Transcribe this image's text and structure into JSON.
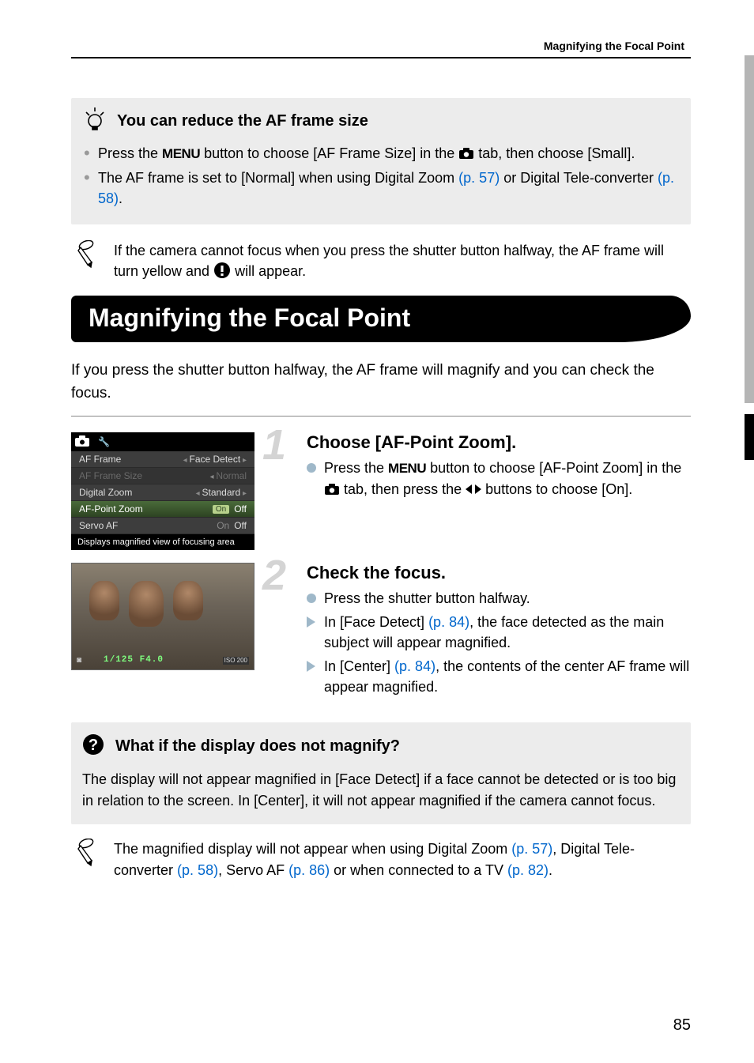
{
  "header": {
    "section": "Magnifying the Focal Point"
  },
  "tip1": {
    "title": "You can reduce the AF frame size",
    "bullets": [
      {
        "pre": "Press the ",
        "menu": "MENU",
        "mid": " button to choose [AF Frame Size] in the ",
        "post": " tab, then choose [Small]."
      },
      {
        "pre": "The AF frame is set to [Normal] when using Digital Zoom ",
        "link1": "(p. 57)",
        "mid": " or Digital Tele-converter ",
        "link2": "(p. 58)",
        "post": "."
      }
    ]
  },
  "note1": {
    "line1": "If the camera cannot focus when you press the shutter button halfway, the AF frame will turn yellow and ",
    "line2": " will appear."
  },
  "section": {
    "title": "Magnifying the Focal Point",
    "intro": "If you press the shutter button halfway, the AF frame will magnify and you can check the focus."
  },
  "menuScreenshot": {
    "rows": [
      {
        "label": "AF Frame",
        "value": "Face Detect",
        "classes": ""
      },
      {
        "label": "AF Frame Size",
        "value": "Normal",
        "classes": "dim"
      },
      {
        "label": "Digital Zoom",
        "value": "Standard",
        "classes": ""
      },
      {
        "label": "AF-Point Zoom",
        "on": "On",
        "off": "Off",
        "classes": "highlight"
      },
      {
        "label": "Servo AF",
        "on": "On",
        "off": "Off",
        "classes": ""
      }
    ],
    "footer": "Displays magnified view of focusing area"
  },
  "photoOverlay": {
    "exposure": "1/125  F4.0",
    "iso": "ISO\n200"
  },
  "step1": {
    "num": "1",
    "heading": "Choose [AF-Point Zoom].",
    "b1a": "Press the ",
    "menu": "MENU",
    "b1b": " button to choose [AF-Point Zoom] in the ",
    "b1c": " tab, then press the ",
    "b1d": " buttons to choose [On]."
  },
  "step2": {
    "num": "2",
    "heading": "Check the focus.",
    "b1": "Press the shutter button halfway.",
    "b2a": "In [Face Detect] ",
    "b2link": "(p. 84)",
    "b2b": ", the face detected as the main subject will appear magnified.",
    "b3a": "In [Center] ",
    "b3link": "(p. 84)",
    "b3b": ", the contents of the center AF frame will appear magnified."
  },
  "qa": {
    "title": "What if the display does not magnify?",
    "body": "The display will not appear magnified in [Face Detect] if a face cannot be detected or is too big in relation to the screen. In [Center], it will not appear magnified if the camera cannot focus."
  },
  "finalNote": {
    "t1": "The magnified display will not appear when using Digital Zoom ",
    "l1": "(p. 57)",
    "t2": ", Digital Tele-converter ",
    "l2": "(p. 58)",
    "t3": ", Servo AF ",
    "l3": "(p. 86)",
    "t4": " or when connected to a TV ",
    "l4": "(p. 82)",
    "t5": "."
  },
  "pageNumber": "85"
}
